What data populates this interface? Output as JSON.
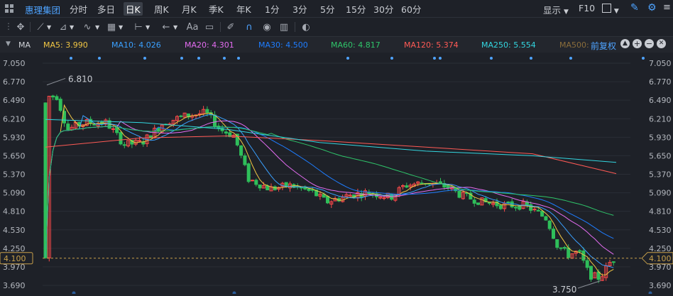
{
  "header": {
    "stock_name": "惠理集团",
    "periods": [
      "分时",
      "多日",
      "日K",
      "周K",
      "月K",
      "季K",
      "年K",
      "1分",
      "3分",
      "5分",
      "15分",
      "30分",
      "60分"
    ],
    "active_period": "日K",
    "display_label": "显示",
    "f10_label": "F10"
  },
  "toolbar": {
    "text_tool_label": "Aa"
  },
  "ma_bar": {
    "indicator": "MA",
    "items": [
      {
        "label": "MA5: 3.990",
        "color": "#f2c744"
      },
      {
        "label": "MA10: 4.026",
        "color": "#3aa0ff"
      },
      {
        "label": "MA20: 4.301",
        "color": "#e36cf0"
      },
      {
        "label": "MA30: 4.500",
        "color": "#1e7dff"
      },
      {
        "label": "MA60: 4.817",
        "color": "#2fc56a"
      },
      {
        "label": "MA120: 5.374",
        "color": "#ff5a55"
      },
      {
        "label": "MA250: 5.554",
        "color": "#33d6e0"
      },
      {
        "label": "MA500: ",
        "color": "#8a6d3b"
      }
    ],
    "adjust_label": "前复权"
  },
  "chart_data": {
    "type": "candlestick",
    "y_ticks": [
      "7.050",
      "6.770",
      "6.490",
      "6.210",
      "5.930",
      "5.650",
      "5.370",
      "5.090",
      "4.810",
      "4.530",
      "4.250",
      "3.970",
      "3.690"
    ],
    "ylim": [
      3.66,
      7.08
    ],
    "current_price_label": "4.100",
    "current_price": 4.1,
    "high_annotation": "6.810",
    "low_annotation": "3.750",
    "colors": {
      "up": "#ff4a4a",
      "down": "#2fbf5a",
      "bg": "#1e2128",
      "grid": "#2a2e36",
      "price_line": "#c8a04a"
    }
  }
}
